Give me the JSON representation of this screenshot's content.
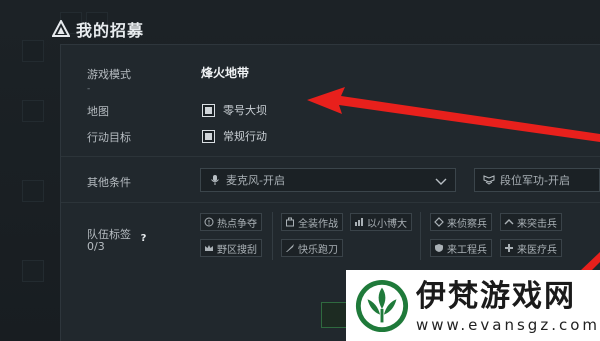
{
  "window": {
    "title": "我的招募"
  },
  "form": {
    "mode_label": "游戏模式",
    "mode_value": "烽火地带",
    "mode_sub": "-",
    "map_label": "地图",
    "map_option": "零号大坝",
    "goal_label": "行动目标",
    "goal_option": "常规行动",
    "conditions_label": "其他条件",
    "mic_select": "麦克风-开启",
    "rank_select": "段位军功-开启",
    "tags_label": "队伍标签",
    "tags_count": "0/3",
    "help_glyph": "?"
  },
  "tags": {
    "t1": "热点争夺",
    "t2": "野区搜刮",
    "t3": "全装作战",
    "t4": "以小博大",
    "t5": "快乐跑刀",
    "t6": "来侦察兵",
    "t7": "来突击兵",
    "t8": "来工程兵",
    "t9": "来医疗兵"
  },
  "watermark": {
    "name": "伊梵游戏网",
    "url": "www.evansgz.com"
  },
  "colors": {
    "background": "#151a1e",
    "panel": "#21282d",
    "arrow": "#e8201c",
    "text": "#c9cfd4"
  },
  "icons": [
    "warning-triangle-icon",
    "microphone-icon",
    "rank-badge-icon",
    "chevron-down-icon",
    "help-icon"
  ]
}
